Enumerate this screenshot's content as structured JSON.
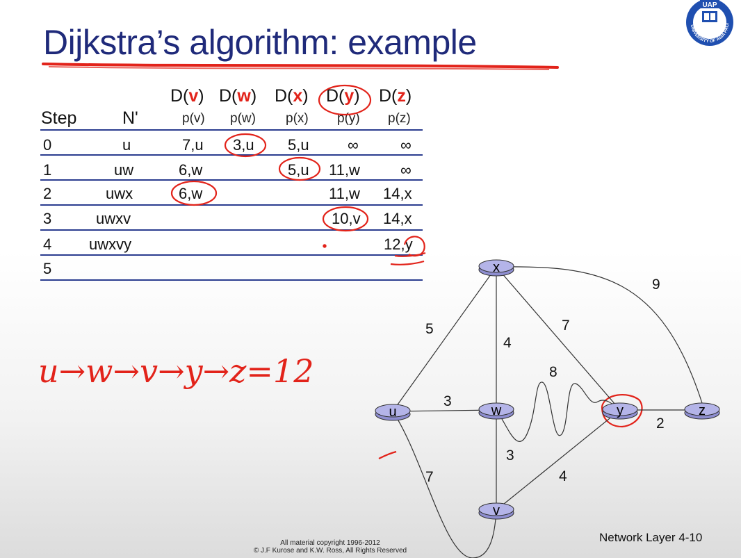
{
  "title": "Dijkstra’s algorithm: example",
  "logo": {
    "top_text": "UAP",
    "ring_text": "UNIVERSITY OF ASIA PACIFIC"
  },
  "table": {
    "headers": [
      {
        "d_prefix": "D(",
        "d_node": "v",
        "d_suffix": ")",
        "p": "p(v)"
      },
      {
        "d_prefix": "D(",
        "d_node": "w",
        "d_suffix": ")",
        "p": "p(w)"
      },
      {
        "d_prefix": "D(",
        "d_node": "x",
        "d_suffix": ")",
        "p": "p(x)"
      },
      {
        "d_prefix": "D(",
        "d_node": "y",
        "d_suffix": ")",
        "p": "p(y)"
      },
      {
        "d_prefix": "D(",
        "d_node": "z",
        "d_suffix": ")",
        "p": "p(z)"
      }
    ],
    "step_label": "Step",
    "nprime_label": "N'",
    "rows": [
      {
        "step": "0",
        "n": "u",
        "cells": [
          "7,u",
          "3,u",
          "5,u",
          "∞",
          "∞"
        ]
      },
      {
        "step": "1",
        "n": "uw",
        "cells": [
          "6,w",
          "",
          "5,u",
          "11,w",
          "∞"
        ]
      },
      {
        "step": "2",
        "n": "uwx",
        "cells": [
          "6,w",
          "",
          "",
          "11,w",
          "14,x"
        ]
      },
      {
        "step": "3",
        "n": "uwxv",
        "cells": [
          "",
          "",
          "",
          "10,v",
          "14,x"
        ]
      },
      {
        "step": "4",
        "n": "uwxvy",
        "cells": [
          "",
          "",
          "",
          "",
          "12,y"
        ]
      },
      {
        "step": "5",
        "n": "",
        "cells": [
          "",
          "",
          "",
          "",
          ""
        ]
      }
    ]
  },
  "handwritten_path": "u→w→v→y→z=12",
  "graph": {
    "nodes": [
      "x",
      "u",
      "w",
      "y",
      "z",
      "v"
    ],
    "edge_weights": {
      "u_x": "5",
      "x_z": "9",
      "x_w": "4",
      "x_y": "7",
      "w_y": "8",
      "u_w": "3",
      "y_z": "2",
      "w_v": "3",
      "u_v": "7",
      "v_y": "4"
    }
  },
  "colors": {
    "title": "#1f2a7a",
    "accent_red": "#e2231a",
    "router_fill": "#a9a9e0",
    "rule": "#2a3c8f"
  },
  "copyright": {
    "line1": "All material copyright 1996-2012",
    "line2": "© J.F Kurose and K.W. Ross, All Rights Reserved"
  },
  "page_label": "Network Layer 4-10"
}
